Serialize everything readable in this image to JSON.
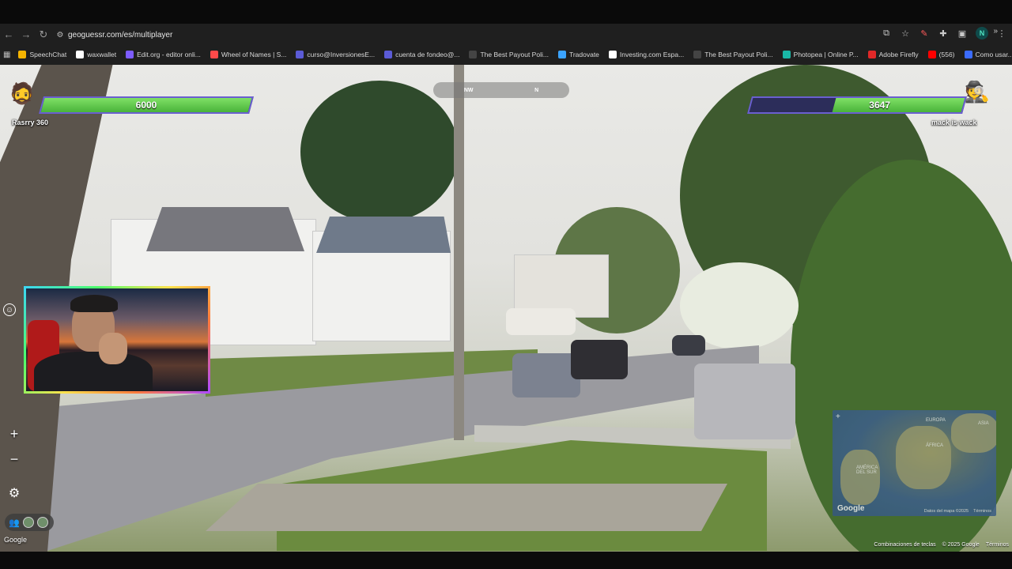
{
  "browser": {
    "url": "geoguessr.com/es/multiplayer",
    "bookmarks": [
      {
        "label": "SpeechChat",
        "color": "#f5b400"
      },
      {
        "label": "waxwallet",
        "color": "#ffffff"
      },
      {
        "label": "Edit.org - editor onli...",
        "color": "#7d5cff"
      },
      {
        "label": "Wheel of Names | S...",
        "color": "#ff4a4a"
      },
      {
        "label": "curso@InversionesE...",
        "color": "#5b5bd6"
      },
      {
        "label": "cuenta de fondeo@...",
        "color": "#5b5bd6"
      },
      {
        "label": "The Best Payout Poli...",
        "color": "#444444"
      },
      {
        "label": "Tradovate",
        "color": "#3ba3ff"
      },
      {
        "label": "Investing.com Espa...",
        "color": "#ffffff"
      },
      {
        "label": "The Best Payout Poli...",
        "color": "#444444"
      },
      {
        "label": "Photopea | Online P...",
        "color": "#19b7a6"
      },
      {
        "label": "Adobe Firefly",
        "color": "#e12828"
      },
      {
        "label": "(556)",
        "color": "#ff0000"
      },
      {
        "label": "Como usar...",
        "color": "#3b6cff"
      }
    ]
  },
  "game": {
    "player_left": {
      "score": "6000",
      "name": "Rasrry 360",
      "health_fraction": 1.0
    },
    "player_right": {
      "score": "3647",
      "name": "mack is wack",
      "health_fraction": 0.61
    },
    "compass": {
      "left": "NW",
      "right": "N"
    },
    "google_label": "Google",
    "minimap": {
      "labels": [
        "EUROPA",
        "ÁFRICA",
        "AMÉRICA DEL SUR",
        "ASIA"
      ],
      "google": "Google",
      "footer": [
        "Datos del mapa ©2025",
        "Términos"
      ]
    },
    "attribution": [
      "Combinaciones de teclas",
      "© 2025 Google",
      "Términos"
    ]
  }
}
